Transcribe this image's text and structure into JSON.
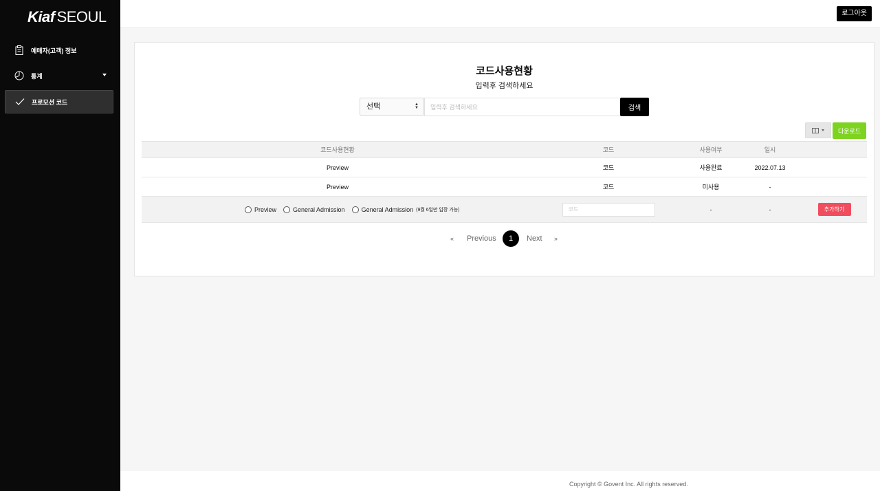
{
  "sidebar": {
    "logo_bold": "Kiaf",
    "logo_thin": "SEOUL",
    "items": [
      {
        "label": "예매자(고객) 정보",
        "icon": "clipboard-icon"
      },
      {
        "label": "통계",
        "icon": "pie-chart-icon"
      },
      {
        "label": "프로모션 코드",
        "icon": "checkmark-icon",
        "active": true
      }
    ]
  },
  "header": {
    "logout_label": "로그아웃"
  },
  "main": {
    "title": "코드사용현황",
    "subtitle": "입력후 검색하세요",
    "search": {
      "select_value": "선택",
      "placeholder": "입력후 검색하세요",
      "button_label": "검색"
    },
    "download_label": "다운로드",
    "table": {
      "headers": [
        "코드사용현황",
        "코드",
        "사용여부",
        "일시"
      ],
      "rows": [
        {
          "type": "Preview",
          "code": "코드",
          "status": "사용완료",
          "date": "2022.07.13"
        },
        {
          "type": "Preview",
          "code": "코드",
          "status": "미사용",
          "date": "-"
        }
      ],
      "add_row": {
        "options": [
          {
            "label": "Preview",
            "note": ""
          },
          {
            "label": "General Admission",
            "note": ""
          },
          {
            "label": "General Admission",
            "note": "(9월 6일만 입장 가능)"
          }
        ],
        "code_placeholder": "코드",
        "status": "-",
        "date": "-",
        "add_label": "추가하기"
      }
    },
    "pagination": {
      "first": "«",
      "previous": "Previous",
      "current": "1",
      "next": "Next",
      "last": "»"
    }
  },
  "footer": {
    "copyright": "Copyright © Govent Inc. All rights reserved."
  },
  "colors": {
    "download": "#7ed321",
    "add": "#f04e5e",
    "sidebar": "#0a0a0a"
  }
}
